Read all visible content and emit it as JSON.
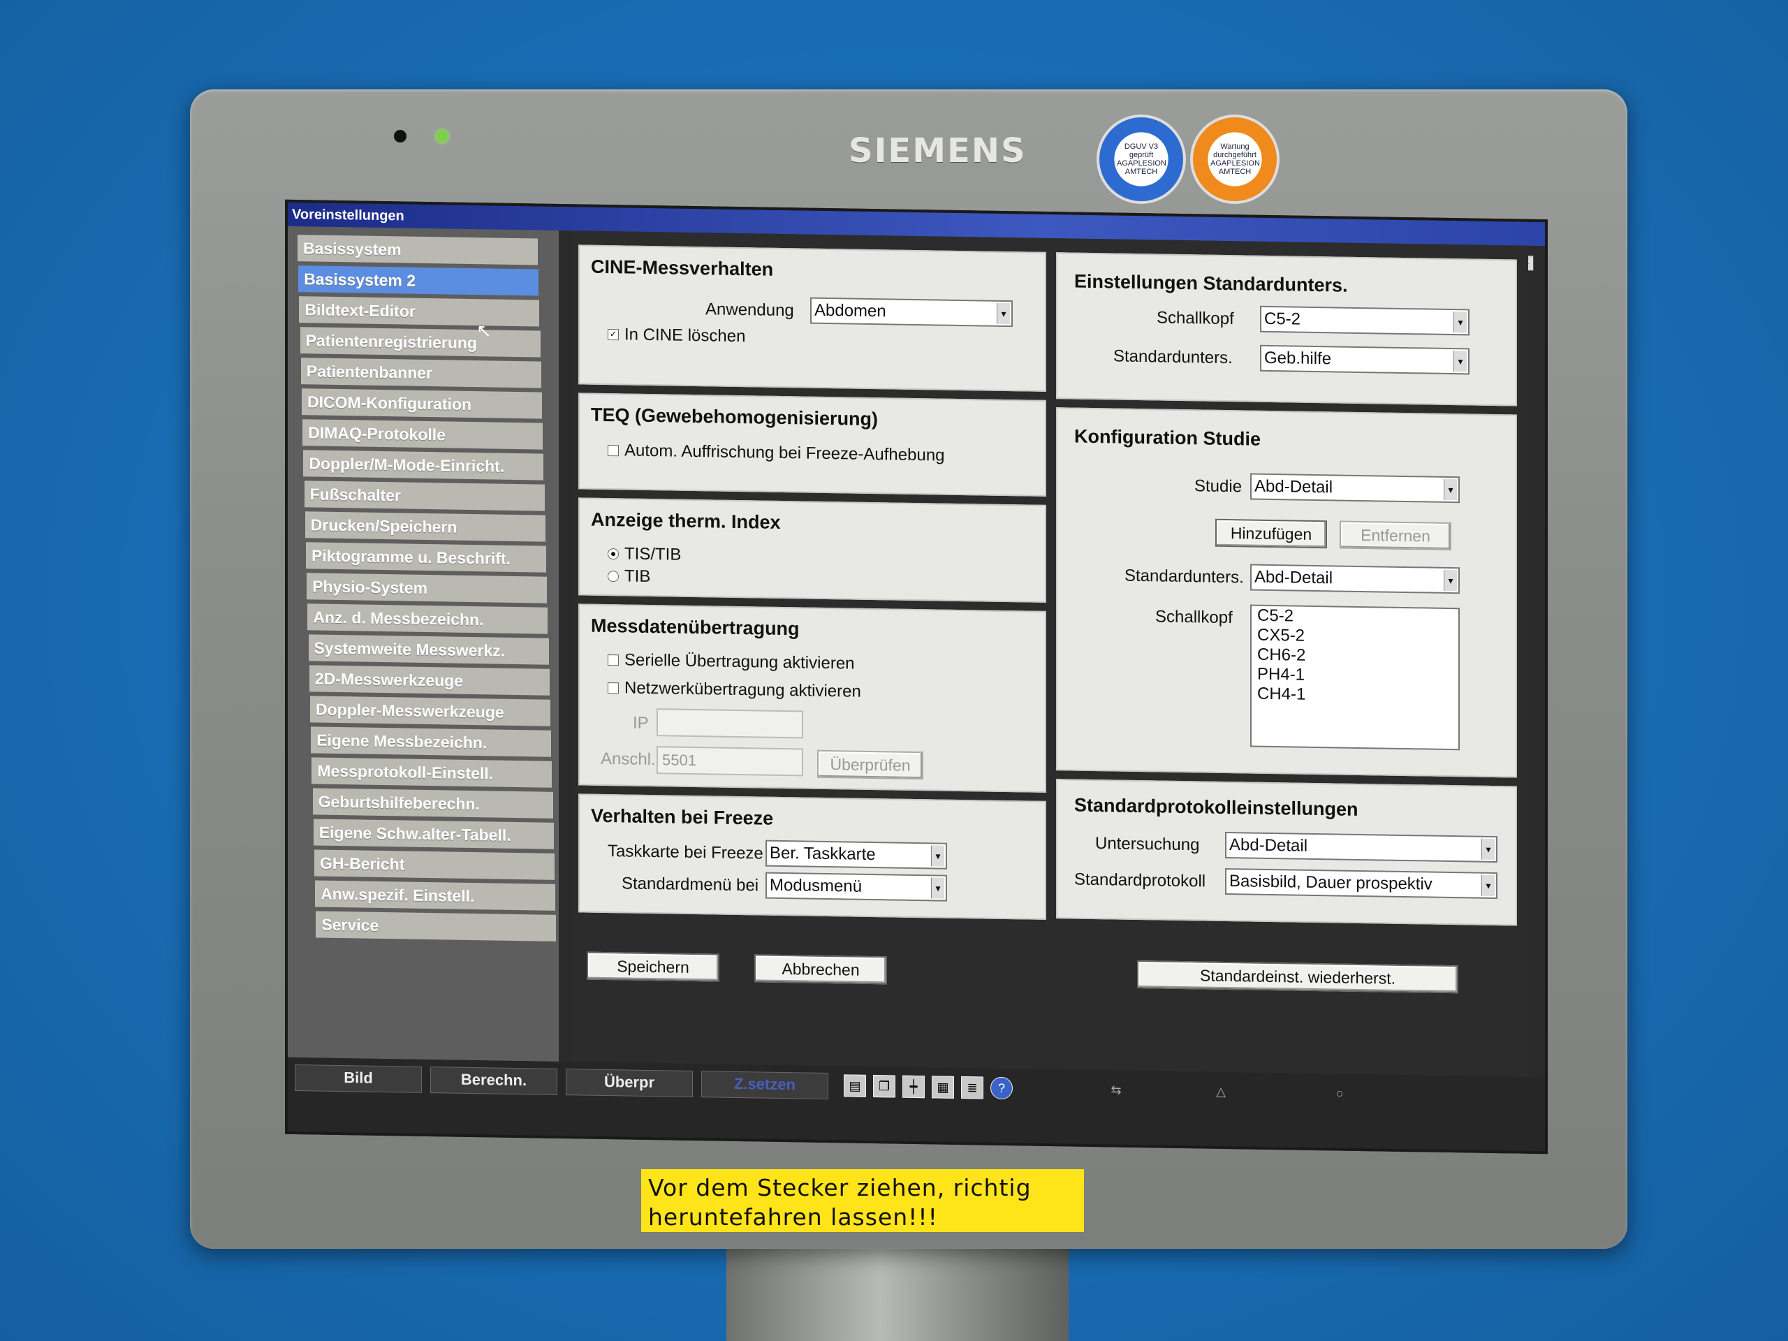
{
  "monitor": {
    "brand": "SIEMENS",
    "sticker_left": "DGUV V3 geprüft AGAPLESION AMTECH",
    "sticker_right": "Wartung durchgeführt AGAPLESION AMTECH",
    "warning": "Vor dem Stecker ziehen, richtig heruntefahren lassen!!!"
  },
  "window": {
    "title": "Voreinstellungen",
    "close_icon": "close-icon"
  },
  "nav": {
    "items": [
      {
        "label": "Basissystem"
      },
      {
        "label": "Basissystem 2",
        "selected": true
      },
      {
        "label": "Bildtext-Editor"
      },
      {
        "label": "Patientenregistrierung"
      },
      {
        "label": "Patientenbanner"
      },
      {
        "label": "DICOM-Konfiguration"
      },
      {
        "label": "DIMAQ-Protokolle"
      },
      {
        "label": "Doppler/M-Mode-Einricht."
      },
      {
        "label": "Fußschalter"
      },
      {
        "label": "Drucken/Speichern"
      },
      {
        "label": "Piktogramme u. Beschrift."
      },
      {
        "label": "Physio-System"
      },
      {
        "label": "Anz. d. Messbezeichn."
      },
      {
        "label": "Systemweite Messwerkz."
      },
      {
        "label": "2D-Messwerkzeuge"
      },
      {
        "label": "Doppler-Messwerkzeuge"
      },
      {
        "label": "Eigene Messbezeichn."
      },
      {
        "label": "Messprotokoll-Einstell."
      },
      {
        "label": "Geburtshilfeberechn."
      },
      {
        "label": "Eigene Schw.alter-Tabell."
      },
      {
        "label": "GH-Bericht"
      },
      {
        "label": "Anw.spezif. Einstell."
      },
      {
        "label": "Service"
      }
    ]
  },
  "cine": {
    "title": "CINE-Messverhalten",
    "anwendung_label": "Anwendung",
    "anwendung_value": "Abdomen",
    "cine_loeschen_label": "In CINE löschen",
    "cine_loeschen_checked": true
  },
  "teq": {
    "title": "TEQ (Gewebehomogenisierung)",
    "autom_label": "Autom. Auffrischung bei Freeze-Aufhebung",
    "autom_checked": false
  },
  "therm": {
    "title": "Anzeige therm. Index",
    "options": [
      "TIS/TIB",
      "TIB"
    ],
    "selected": "TIS/TIB"
  },
  "mess": {
    "title": "Messdatenübertragung",
    "seriell_label": "Serielle Übertragung aktivieren",
    "netzwerk_label": "Netzwerkübertragung aktivieren",
    "ip_label": "IP",
    "ip_value": "",
    "anschl_label": "Anschl.",
    "anschl_value": "5501",
    "check_button": "Überprüfen"
  },
  "freeze": {
    "title": "Verhalten bei Freeze",
    "taskkarte_label": "Taskkarte bei Freeze",
    "taskkarte_value": "Ber. Taskkarte",
    "standardmenu_label": "Standardmenü bei",
    "standardmenu_value": "Modusmenü"
  },
  "standard": {
    "title": "Einstellungen Standardunters.",
    "schallkopf_label": "Schallkopf",
    "schallkopf_value": "C5-2",
    "standardunters_label": "Standardunters.",
    "standardunters_value": "Geb.hilfe"
  },
  "studie": {
    "title": "Konfiguration Studie",
    "studie_label": "Studie",
    "studie_value": "Abd-Detail",
    "add_button": "Hinzufügen",
    "remove_button": "Entfernen",
    "standardunters_label": "Standardunters.",
    "standardunters_value": "Abd-Detail",
    "schallkopf_label": "Schallkopf",
    "schallkopf_list": [
      "C5-2",
      "CX5-2",
      "CH6-2",
      "PH4-1",
      "CH4-1"
    ]
  },
  "protokoll": {
    "title": "Standardprotokolleinstellungen",
    "untersuchung_label": "Untersuchung",
    "untersuchung_value": "Abd-Detail",
    "standardprotokoll_label": "Standardprotokoll",
    "standardprotokoll_value": "Basisbild, Dauer prospektiv"
  },
  "actions": {
    "save": "Speichern",
    "cancel": "Abbrechen",
    "restore": "Standardeinst. wiederherst."
  },
  "taskbar": {
    "buttons": [
      "Bild",
      "Berechn.",
      "Überpr",
      "Z.setzen"
    ],
    "icons": [
      "folder-icon",
      "copy-icon",
      "tree-icon",
      "grid-icon",
      "document-icon",
      "help-icon",
      "arrows-icon",
      "triangle-icon",
      "circle-icon"
    ]
  },
  "colors": {
    "selected_nav": "#5b8de0",
    "titlebar": "#2c44a8",
    "warning": "#ffe419"
  }
}
